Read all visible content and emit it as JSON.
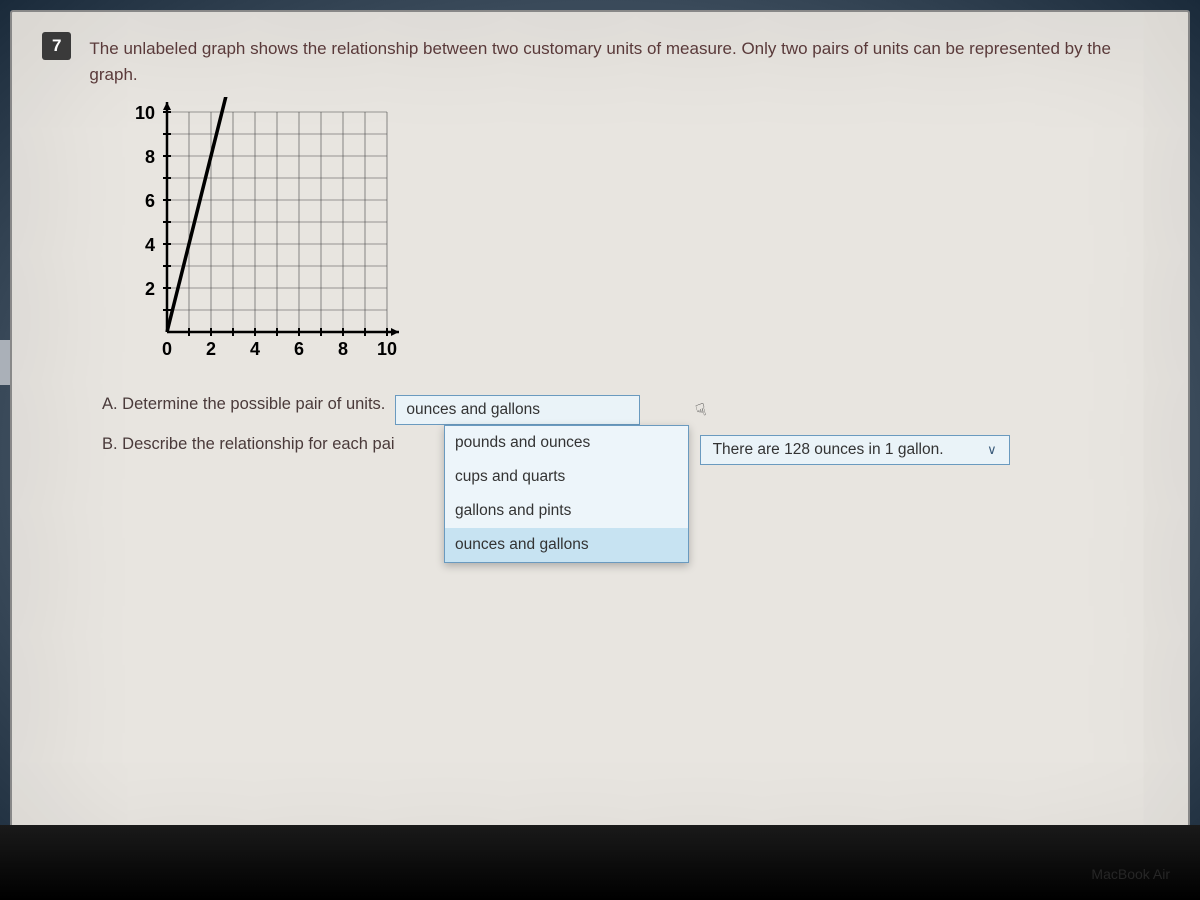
{
  "question": {
    "number": "7",
    "text": "The unlabeled graph shows the relationship between two customary units of measure. Only two pairs of units can be represented by the graph."
  },
  "chart_data": {
    "type": "line",
    "x": [
      0,
      1,
      2,
      3
    ],
    "y": [
      0,
      4,
      8,
      12
    ],
    "xlim": [
      0,
      11
    ],
    "ylim": [
      0,
      11
    ],
    "xlabel": "",
    "ylabel": "",
    "title": "",
    "x_ticks": [
      "0",
      "2",
      "4",
      "6",
      "8",
      "10"
    ],
    "y_ticks": [
      "2",
      "4",
      "6",
      "8",
      "10"
    ]
  },
  "sub": {
    "a_label": "A. Determine the possible pair of units.",
    "b_label": "B. Describe the relationship for each pai"
  },
  "dropdown1": {
    "selected": "ounces and gallons",
    "options": [
      "pounds and ounces",
      "cups and quarts",
      "gallons and pints",
      "ounces and gallons"
    ],
    "highlight_index": 3
  },
  "dropdown2": {
    "selected": "There are 128 ounces in 1 gallon."
  },
  "footer": {
    "device": "MacBook Air"
  }
}
